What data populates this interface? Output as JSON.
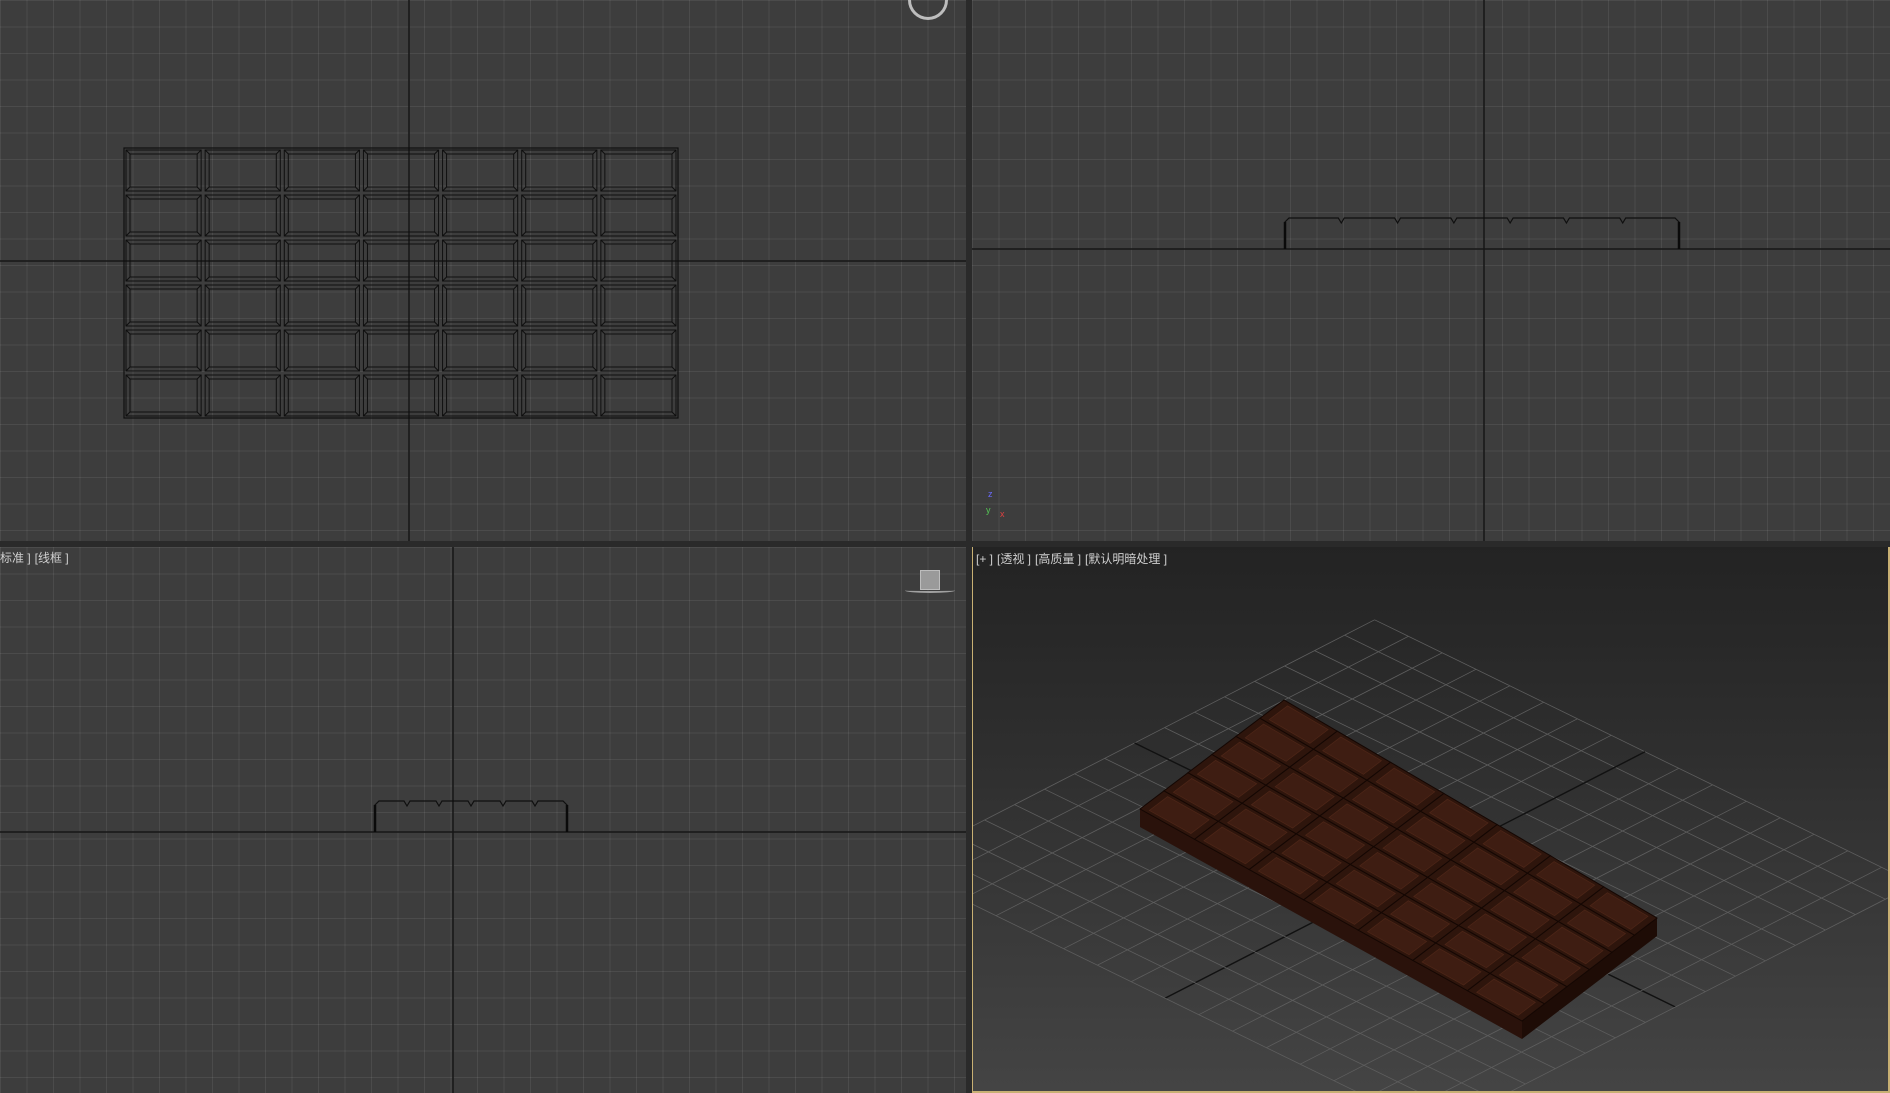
{
  "viewports": {
    "bottom_left": {
      "labels": [
        "标准 ]",
        "[线框 ]"
      ]
    },
    "perspective": {
      "labels": [
        "[+ ]",
        "[透视 ]",
        "[高质量 ]",
        "[默认明暗处理 ]"
      ]
    }
  },
  "axis_gizmo": {
    "z": "z",
    "y": "y",
    "x": "x"
  },
  "object": {
    "grid_columns": 7,
    "grid_rows": 6
  },
  "colors": {
    "chocolate_top": "#3e1d12",
    "chocolate_side": "#2a120b",
    "chocolate_groove": "#1a0a05",
    "active_border": "#c8b073"
  }
}
